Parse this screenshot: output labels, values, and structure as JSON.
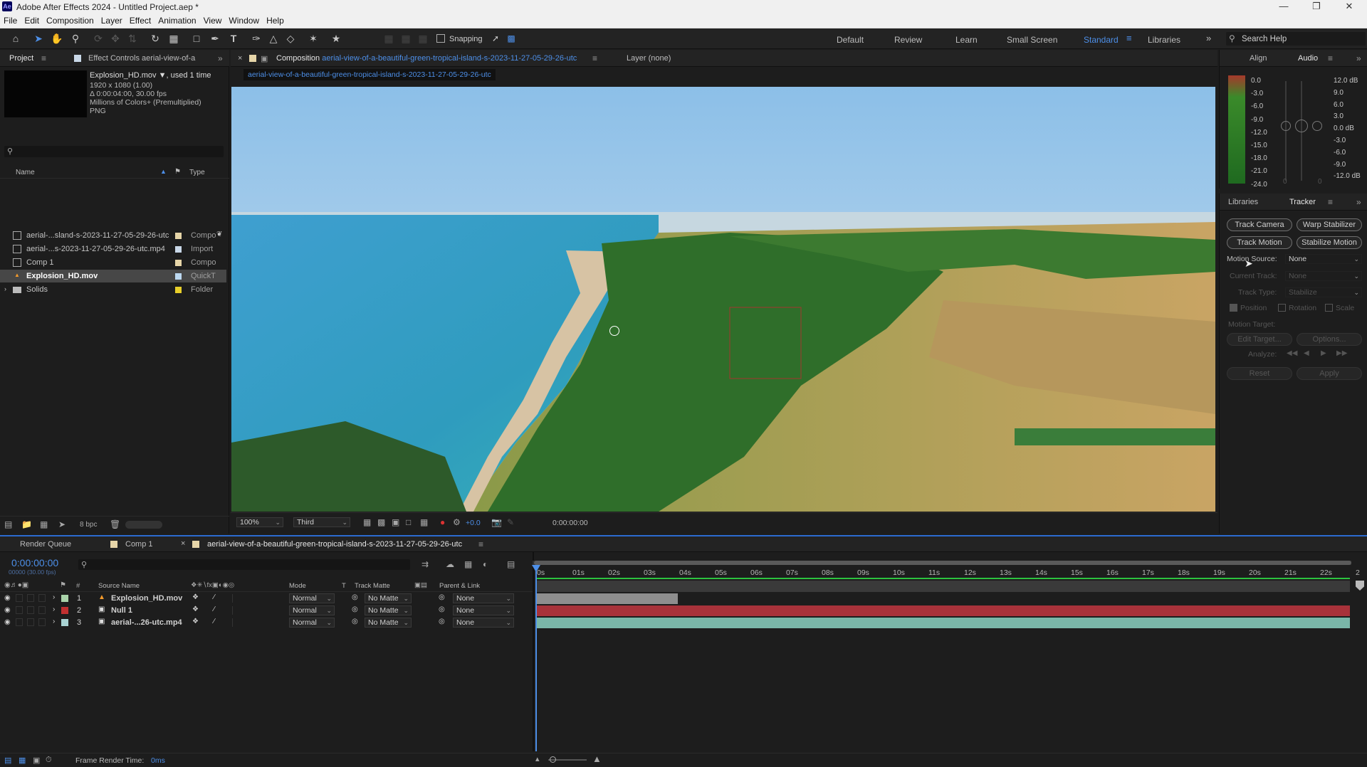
{
  "window": {
    "title": "Adobe After Effects 2024 - Untitled Project.aep *",
    "app_icon": "Ae"
  },
  "menu": [
    "File",
    "Edit",
    "Composition",
    "Layer",
    "Effect",
    "Animation",
    "View",
    "Window",
    "Help"
  ],
  "toolbar": {
    "snapping_label": "Snapping",
    "snapping_checked": false,
    "tools": [
      "home-icon",
      "selection-tool-icon",
      "hand-tool-icon",
      "zoom-tool-icon",
      "orbit-camera-icon",
      "pan-camera-icon",
      "dolly-camera-icon",
      "rotation-tool-icon",
      "pan-behind-tool-icon",
      "rectangle-tool-icon",
      "pen-tool-icon",
      "type-tool-icon",
      "brush-tool-icon",
      "clone-stamp-icon",
      "eraser-tool-icon",
      "roto-brush-icon",
      "puppet-pin-icon"
    ]
  },
  "workspaces": {
    "items": [
      "Default",
      "Review",
      "Learn",
      "Small Screen",
      "Standard",
      "Libraries"
    ],
    "active": "Standard",
    "search_placeholder": "Search Help"
  },
  "project_panel": {
    "tab_project": "Project",
    "tab_effect_controls": "Effect Controls aerial-view-of-a",
    "selected_name": "Explosion_HD.mov",
    "used": ", used 1 time",
    "info": [
      "1920 x 1080 (1.00)",
      "Δ 0:00:04:00, 30.00 fps",
      "Millions of Colors+ (Premultiplied)",
      "PNG"
    ],
    "col_name": "Name",
    "col_type": "Type",
    "items": [
      {
        "name": "aerial-...sland-s-2023-11-27-05-29-26-utc",
        "type": "Compo",
        "label_color": "#e6d5a8",
        "icon": "composition-icon",
        "selected": false
      },
      {
        "name": "aerial-...s-2023-11-27-05-29-26-utc.mp4",
        "type": "Import",
        "label_color": "#c9d8e8",
        "icon": "footage-icon",
        "selected": false
      },
      {
        "name": "Comp 1",
        "type": "Compo",
        "label_color": "#e6d5a8",
        "icon": "composition-icon",
        "selected": false
      },
      {
        "name": "Explosion_HD.mov",
        "type": "QuickT",
        "label_color": "#bcd8f0",
        "icon": "quicktime-icon",
        "selected": true
      },
      {
        "name": "Solids",
        "type": "Folder",
        "label_color": "#e8cf2a",
        "icon": "folder-icon",
        "selected": false
      }
    ],
    "bpc": "8 bpc"
  },
  "comp_panel": {
    "tab_label": "Composition",
    "comp_name": "aerial-view-of-a-beautiful-green-tropical-island-s-2023-11-27-05-29-26-utc",
    "layer_tab": "Layer (none)",
    "subtab": "aerial-view-of-a-beautiful-green-tropical-island-s-2023-11-27-05-29-26-utc",
    "zoom": "100%",
    "resolution": "Third",
    "exposure": "+0.0",
    "timecode": "0:00:00:00"
  },
  "audio_panel": {
    "tab_align": "Align",
    "tab_audio": "Audio",
    "left_scale": [
      "0.0",
      "-3.0",
      "-6.0",
      "-9.0",
      "-12.0",
      "-15.0",
      "-18.0",
      "-21.0",
      "-24.0"
    ],
    "right_scale": [
      "12.0 dB",
      "9.0",
      "6.0",
      "3.0",
      "0.0 dB",
      "-3.0",
      "-6.0",
      "-9.0",
      "-12.0 dB"
    ],
    "slider_zero_left": "0",
    "slider_zero_right": "0"
  },
  "tracker_panel": {
    "tab_libraries": "Libraries",
    "tab_tracker": "Tracker",
    "buttons": [
      "Track Camera",
      "Warp Stabilizer",
      "Track Motion",
      "Stabilize Motion"
    ],
    "motion_source_label": "Motion Source:",
    "motion_source_value": "None",
    "current_track_label": "Current Track:",
    "current_track_value": "None",
    "track_type_label": "Track Type:",
    "track_type_value": "Stabilize",
    "checks": [
      "Position",
      "Rotation",
      "Scale"
    ],
    "motion_target_label": "Motion Target:",
    "edit_target": "Edit Target...",
    "options": "Options...",
    "analyze_label": "Analyze:",
    "reset": "Reset",
    "apply": "Apply"
  },
  "timeline": {
    "tabs": [
      "Render Queue",
      "Comp 1",
      "aerial-view-of-a-beautiful-green-tropical-island-s-2023-11-27-05-29-26-utc"
    ],
    "timecode": "0:00:00:00",
    "fps": "00000 (30.00 fps)",
    "col_source": "Source Name",
    "col_mode": "Mode",
    "col_t": "T",
    "col_track_matte": "Track Matte",
    "col_parent": "Parent & Link",
    "ruler": [
      "0s",
      "01s",
      "02s",
      "03s",
      "04s",
      "05s",
      "06s",
      "07s",
      "08s",
      "09s",
      "10s",
      "11s",
      "12s",
      "13s",
      "14s",
      "15s",
      "16s",
      "17s",
      "18s",
      "19s",
      "20s",
      "21s",
      "22s",
      "2"
    ],
    "layers": [
      {
        "num": "1",
        "name": "Explosion_HD.mov",
        "color": "#a9d3a9",
        "icon": "quicktime-icon",
        "mode": "Normal",
        "matte": "No Matte",
        "parent": "None",
        "bar_color": "#8e8e8e",
        "bar_end_fraction": 0.175
      },
      {
        "num": "2",
        "name": "Null 1",
        "color": "#c03030",
        "icon": "null-icon",
        "mode": "Normal",
        "matte": "No Matte",
        "parent": "None",
        "bar_color": "#a8323a",
        "bar_end_fraction": 1.0
      },
      {
        "num": "3",
        "name": "aerial-...26-utc.mp4",
        "color": "#a9d3d3",
        "icon": "footage-icon",
        "mode": "Normal",
        "matte": "No Matte",
        "parent": "None",
        "bar_color": "#7ab6a8",
        "bar_end_fraction": 1.0
      }
    ],
    "frame_render_label": "Frame Render Time:",
    "frame_render_value": "0ms"
  }
}
